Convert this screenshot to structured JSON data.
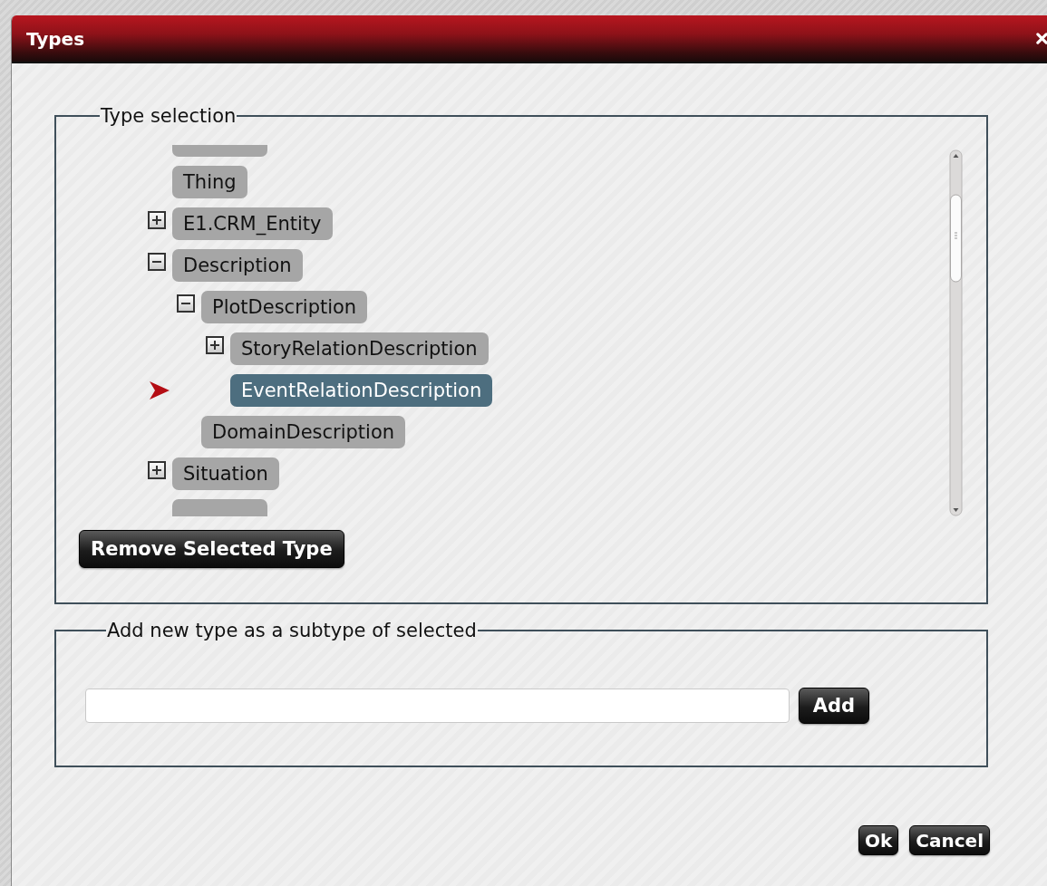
{
  "window": {
    "title": "Types"
  },
  "type_selection": {
    "legend": "Type selection",
    "tree": [
      {
        "kind": "leaf",
        "selected": false
      },
      {
        "kind": "leaf",
        "label": "Thing",
        "selected": false
      },
      {
        "kind": "branch",
        "label": "E1.CRM_Entity",
        "expanded": false,
        "selected": false
      },
      {
        "kind": "branch",
        "label": "Description",
        "expanded": true,
        "selected": false,
        "children": [
          {
            "kind": "branch",
            "label": "PlotDescription",
            "expanded": true,
            "selected": false,
            "children": [
              {
                "kind": "branch",
                "label": "StoryRelationDescription",
                "expanded": false,
                "selected": false
              },
              {
                "kind": "leaf",
                "label": "EventRelationDescription",
                "selected": true
              }
            ]
          },
          {
            "kind": "leaf",
            "label": "DomainDescription",
            "selected": false
          }
        ]
      },
      {
        "kind": "branch",
        "label": "Situation",
        "expanded": false,
        "selected": false
      },
      {
        "kind": "leaf",
        "selected": false
      }
    ],
    "remove_button": "Remove Selected Type"
  },
  "add_type": {
    "legend": "Add new type as a subtype of selected",
    "add_button": "Add"
  },
  "buttons": [
    "Ok",
    "Cancel"
  ]
}
